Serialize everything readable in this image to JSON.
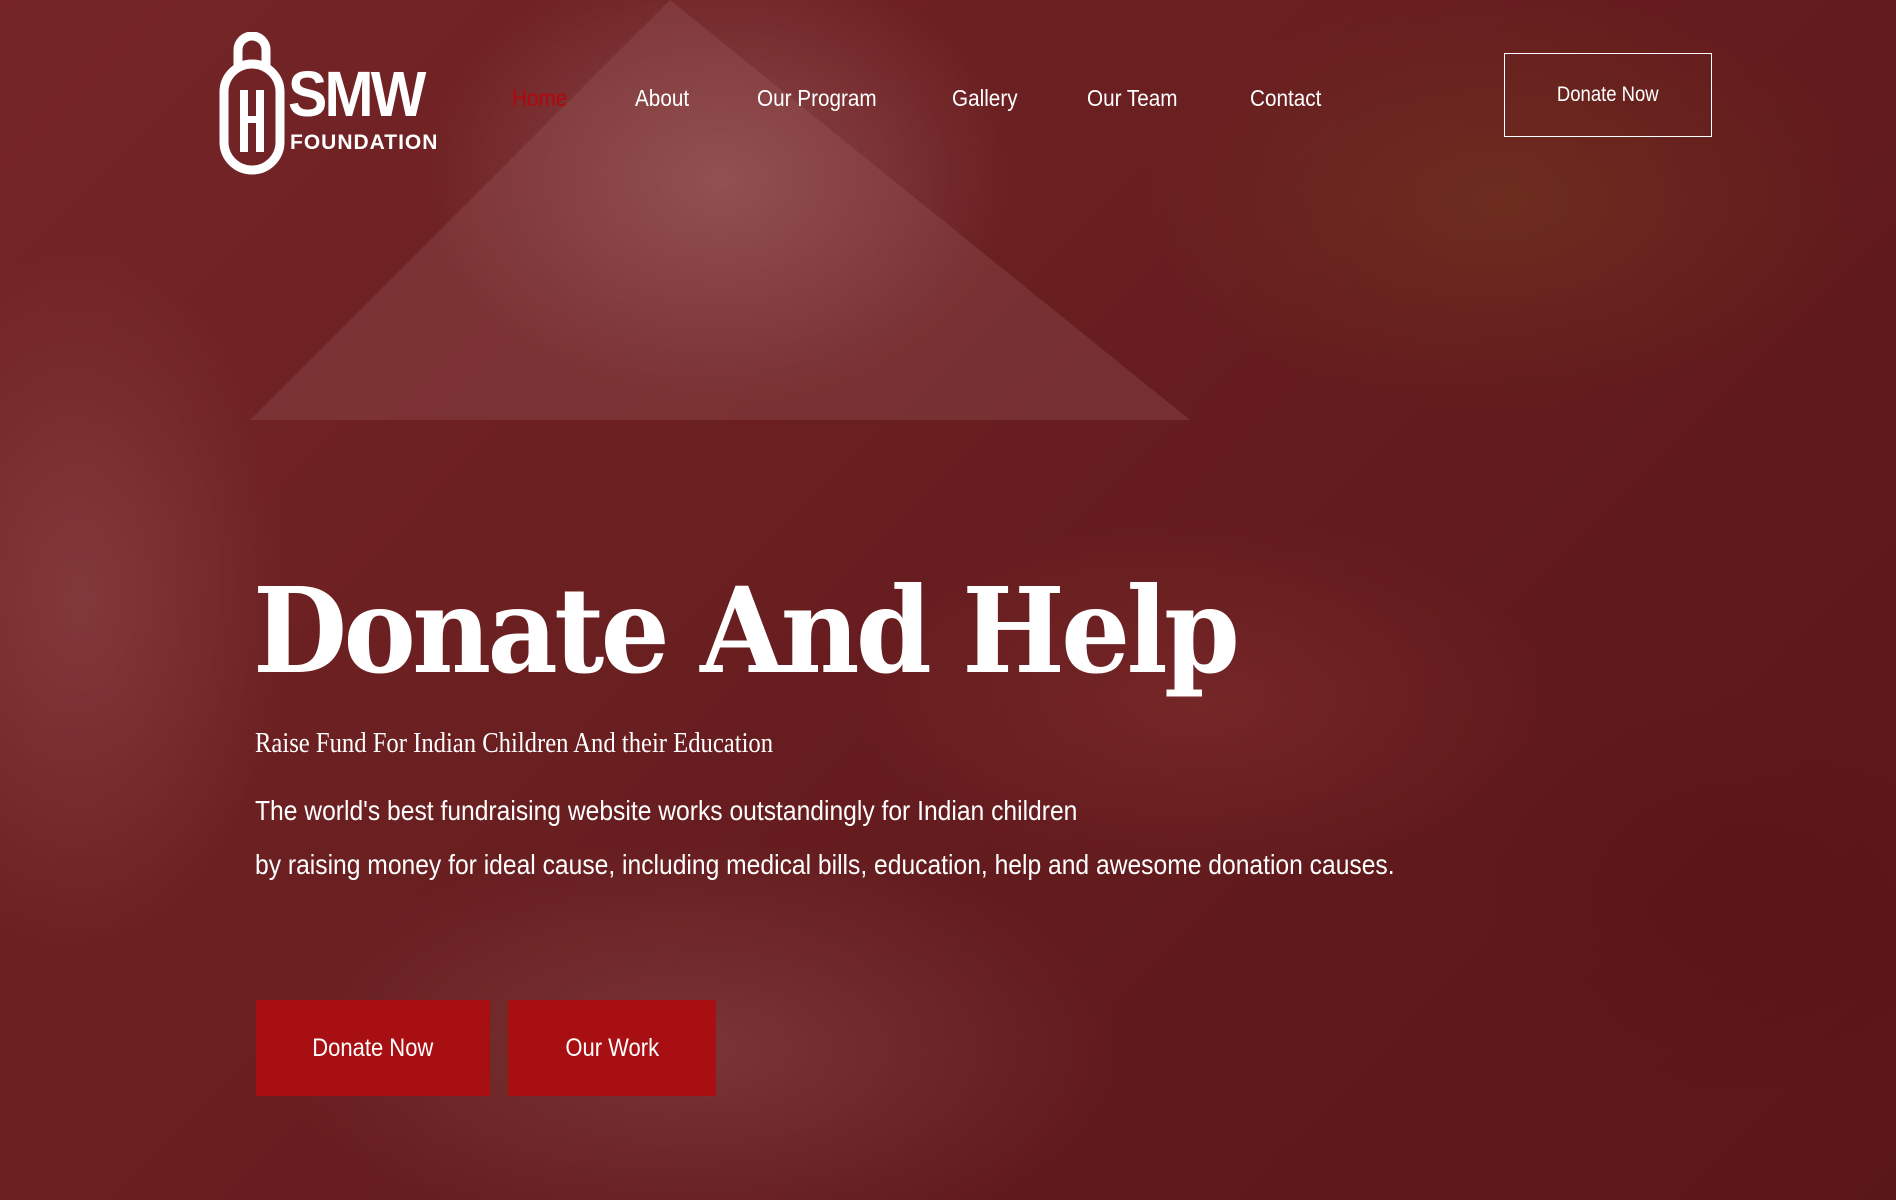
{
  "brand": {
    "name": "SMW",
    "tagline": "FOUNDATION",
    "logo_icon": "smw-logo-icon"
  },
  "nav": {
    "items": [
      {
        "label": "Home",
        "active": true
      },
      {
        "label": "About",
        "active": false
      },
      {
        "label": "Our Program",
        "active": false
      },
      {
        "label": "Gallery",
        "active": false
      },
      {
        "label": "Our Team",
        "active": false
      },
      {
        "label": "Contact",
        "active": false
      }
    ],
    "cta_label": "Donate Now"
  },
  "hero": {
    "title": "Donate And Help",
    "subtitle": "Raise Fund For Indian Children And their Education",
    "description_lines": [
      "The world's best fundraising website works outstandingly for Indian children",
      "by raising money for ideal cause, including medical bills, education, help and awesome donation causes."
    ],
    "primary_button": "Donate Now",
    "secondary_button": "Our Work"
  },
  "colors": {
    "accent": "#a70f12",
    "active_nav": "#b3060b",
    "overlay": "#6e1416",
    "text": "#ffffff"
  }
}
